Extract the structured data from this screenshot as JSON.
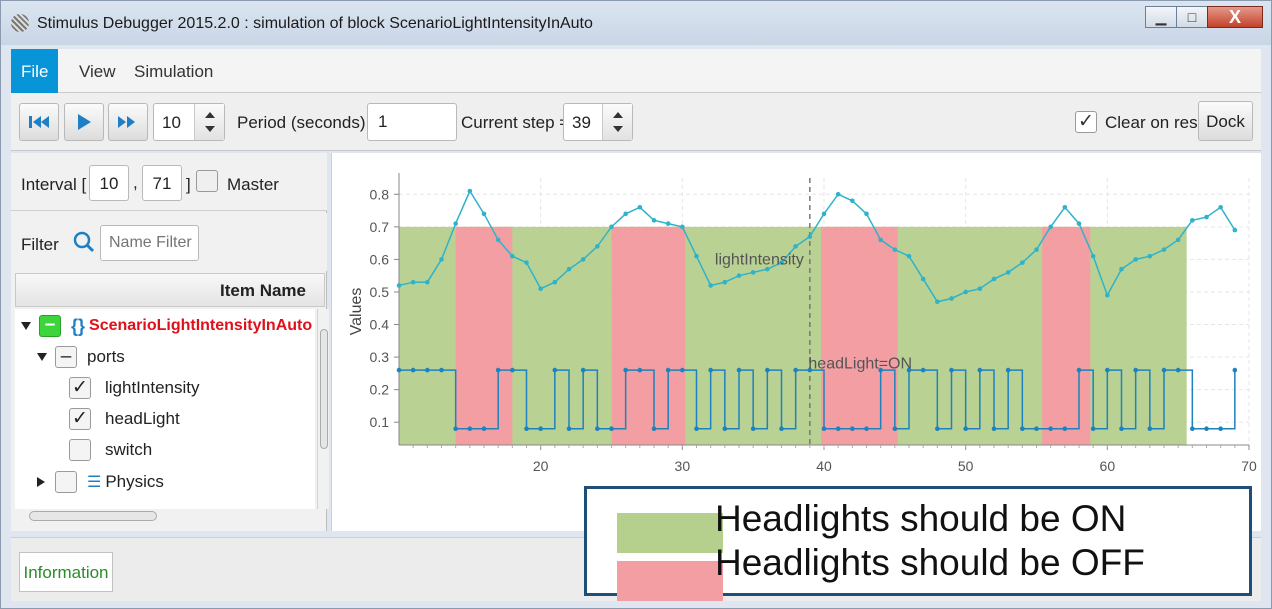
{
  "window": {
    "title": "Stimulus Debugger 2015.2.0 : simulation of block ScenarioLightIntensityInAuto",
    "controls": {
      "minimize": "▁",
      "maximize": "□",
      "close": "X"
    }
  },
  "menu": {
    "file": "File",
    "view": "View",
    "simulation": "Simulation"
  },
  "toolbar": {
    "rewind_icon": "rewind-icon",
    "play_icon": "play-icon",
    "fast_forward_icon": "fast-forward-icon",
    "step_count": "10",
    "period_label": "Period (seconds) =",
    "period_value": "1",
    "current_step_label": "Current step =",
    "current_step_value": "39",
    "clear_on_reset_label": "Clear on reset",
    "clear_on_reset_checked": "✓",
    "dock_label": "Dock"
  },
  "left_panel": {
    "interval_label": "Interval [",
    "interval_start": "10",
    "interval_sep": ",",
    "interval_end": "71",
    "interval_close": "]",
    "master_label": "Master",
    "filter_label": "Filter",
    "filter_placeholder": "Name Filter",
    "column_header": "Item Name",
    "tree": [
      {
        "label": "ScenarioLightIntensityInAuto",
        "box": "–",
        "icon": "block-brace-icon",
        "expanded": true
      },
      {
        "label": "ports",
        "box": "–",
        "expanded": true
      },
      {
        "label": "lightIntensity",
        "box": "✓"
      },
      {
        "label": "headLight",
        "box": "✓"
      },
      {
        "label": "switch",
        "box": ""
      },
      {
        "label": "Physics",
        "box": "",
        "icon": "list-icon",
        "expanded": false
      }
    ]
  },
  "chart_data": {
    "type": "line",
    "ylabel": "Values",
    "xlabel": "",
    "xlim": [
      10,
      70
    ],
    "ylim": [
      0.03,
      0.85
    ],
    "xticks": [
      20,
      30,
      40,
      50,
      60,
      70
    ],
    "yticks": [
      0.1,
      0.2,
      0.3,
      0.4,
      0.5,
      0.6,
      0.7,
      0.8
    ],
    "current_step_marker": 39,
    "regions": [
      {
        "kind": "on",
        "from": 10,
        "to": 65.6
      },
      {
        "kind": "off",
        "from": 14,
        "to": 18
      },
      {
        "kind": "off",
        "from": 25,
        "to": 30.2
      },
      {
        "kind": "off",
        "from": 39.8,
        "to": 45.2
      },
      {
        "kind": "off",
        "from": 55.4,
        "to": 58.8
      }
    ],
    "series": [
      {
        "name": "lightIntensity",
        "color": "#2fb3c9",
        "x": [
          10,
          11,
          12,
          13,
          14,
          15,
          16,
          17,
          18,
          19,
          20,
          21,
          22,
          23,
          24,
          25,
          26,
          27,
          28,
          29,
          30,
          31,
          32,
          33,
          34,
          35,
          36,
          37,
          38,
          39,
          40,
          41,
          42,
          43,
          44,
          45,
          46,
          47,
          48,
          49,
          50,
          51,
          52,
          53,
          54,
          55,
          56,
          57,
          58,
          59,
          60,
          61,
          62,
          63,
          64,
          65,
          66,
          67,
          68,
          69
        ],
        "values": [
          0.52,
          0.53,
          0.53,
          0.6,
          0.71,
          0.81,
          0.74,
          0.66,
          0.61,
          0.59,
          0.51,
          0.53,
          0.57,
          0.6,
          0.64,
          0.7,
          0.74,
          0.76,
          0.72,
          0.71,
          0.7,
          0.61,
          0.52,
          0.53,
          0.55,
          0.56,
          0.57,
          0.59,
          0.64,
          0.67,
          0.74,
          0.8,
          0.78,
          0.74,
          0.66,
          0.63,
          0.61,
          0.54,
          0.47,
          0.48,
          0.5,
          0.51,
          0.54,
          0.56,
          0.59,
          0.63,
          0.7,
          0.76,
          0.71,
          0.61,
          0.49,
          0.57,
          0.6,
          0.61,
          0.63,
          0.66,
          0.72,
          0.73,
          0.76,
          0.69
        ]
      },
      {
        "name": "headLight",
        "color": "#1d82bd",
        "x": [
          10,
          11,
          12,
          13,
          14,
          15,
          16,
          17,
          18,
          19,
          20,
          21,
          22,
          23,
          24,
          25,
          26,
          27,
          28,
          29,
          30,
          31,
          32,
          33,
          34,
          35,
          36,
          37,
          38,
          39,
          40,
          41,
          42,
          43,
          44,
          45,
          46,
          47,
          48,
          49,
          50,
          51,
          52,
          53,
          54,
          55,
          56,
          57,
          58,
          59,
          60,
          61,
          62,
          63,
          64,
          65,
          66,
          67,
          68,
          69
        ],
        "values": [
          0.26,
          0.26,
          0.26,
          0.26,
          0.08,
          0.08,
          0.08,
          0.26,
          0.26,
          0.08,
          0.08,
          0.26,
          0.08,
          0.26,
          0.08,
          0.08,
          0.26,
          0.26,
          0.08,
          0.26,
          0.26,
          0.08,
          0.26,
          0.08,
          0.26,
          0.08,
          0.26,
          0.08,
          0.26,
          0.26,
          0.08,
          0.08,
          0.08,
          0.08,
          0.26,
          0.08,
          0.26,
          0.26,
          0.08,
          0.26,
          0.08,
          0.26,
          0.08,
          0.26,
          0.08,
          0.08,
          0.08,
          0.08,
          0.26,
          0.08,
          0.26,
          0.08,
          0.26,
          0.08,
          0.26,
          0.26,
          0.08,
          0.08,
          0.08,
          0.26
        ]
      }
    ],
    "annotations": [
      {
        "text": "lightIntensity",
        "x": 32.3,
        "y": 0.6
      },
      {
        "text": "headLight=ON",
        "x": 38.9,
        "y": 0.28
      }
    ]
  },
  "bottom": {
    "information_tab": "Information"
  },
  "legend": {
    "on_label": "Headlights should be ON",
    "off_label": "Headlights should be OFF",
    "on_color": "#b5cf8d",
    "off_color": "#f29ea2"
  }
}
